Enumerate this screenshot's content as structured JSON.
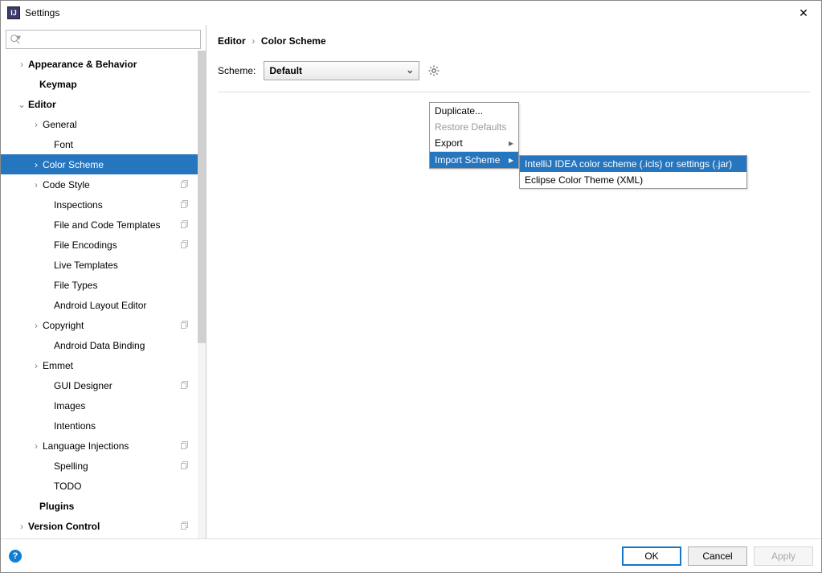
{
  "title": "Settings",
  "search_placeholder": "",
  "tree": [
    {
      "label": "Appearance & Behavior",
      "bold": true,
      "arrow": "›",
      "indent": 20,
      "copy": false
    },
    {
      "label": "Keymap",
      "bold": true,
      "arrow": "",
      "indent": 34,
      "copy": false
    },
    {
      "label": "Editor",
      "bold": true,
      "arrow": "⌄",
      "indent": 20,
      "copy": false
    },
    {
      "label": "General",
      "bold": false,
      "arrow": "›",
      "indent": 38,
      "copy": false
    },
    {
      "label": "Font",
      "bold": false,
      "arrow": "",
      "indent": 52,
      "copy": false
    },
    {
      "label": "Color Scheme",
      "bold": false,
      "arrow": "›",
      "indent": 38,
      "copy": false,
      "selected": true
    },
    {
      "label": "Code Style",
      "bold": false,
      "arrow": "›",
      "indent": 38,
      "copy": true
    },
    {
      "label": "Inspections",
      "bold": false,
      "arrow": "",
      "indent": 52,
      "copy": true
    },
    {
      "label": "File and Code Templates",
      "bold": false,
      "arrow": "",
      "indent": 52,
      "copy": true
    },
    {
      "label": "File Encodings",
      "bold": false,
      "arrow": "",
      "indent": 52,
      "copy": true
    },
    {
      "label": "Live Templates",
      "bold": false,
      "arrow": "",
      "indent": 52,
      "copy": false
    },
    {
      "label": "File Types",
      "bold": false,
      "arrow": "",
      "indent": 52,
      "copy": false
    },
    {
      "label": "Android Layout Editor",
      "bold": false,
      "arrow": "",
      "indent": 52,
      "copy": false
    },
    {
      "label": "Copyright",
      "bold": false,
      "arrow": "›",
      "indent": 38,
      "copy": true
    },
    {
      "label": "Android Data Binding",
      "bold": false,
      "arrow": "",
      "indent": 52,
      "copy": false
    },
    {
      "label": "Emmet",
      "bold": false,
      "arrow": "›",
      "indent": 38,
      "copy": false
    },
    {
      "label": "GUI Designer",
      "bold": false,
      "arrow": "",
      "indent": 52,
      "copy": true
    },
    {
      "label": "Images",
      "bold": false,
      "arrow": "",
      "indent": 52,
      "copy": false
    },
    {
      "label": "Intentions",
      "bold": false,
      "arrow": "",
      "indent": 52,
      "copy": false
    },
    {
      "label": "Language Injections",
      "bold": false,
      "arrow": "›",
      "indent": 38,
      "copy": true
    },
    {
      "label": "Spelling",
      "bold": false,
      "arrow": "",
      "indent": 52,
      "copy": true
    },
    {
      "label": "TODO",
      "bold": false,
      "arrow": "",
      "indent": 52,
      "copy": false
    },
    {
      "label": "Plugins",
      "bold": true,
      "arrow": "",
      "indent": 34,
      "copy": false
    },
    {
      "label": "Version Control",
      "bold": true,
      "arrow": "›",
      "indent": 20,
      "copy": true
    }
  ],
  "breadcrumb": {
    "a": "Editor",
    "b": "Color Scheme"
  },
  "scheme_label": "Scheme:",
  "scheme_value": "Default",
  "menu1": [
    {
      "label": "Duplicate...",
      "disabled": false,
      "sub": false
    },
    {
      "label": "Restore Defaults",
      "disabled": true,
      "sub": false
    },
    {
      "label": "Export",
      "disabled": false,
      "sub": true
    },
    {
      "sep": true
    },
    {
      "label": "Import Scheme",
      "disabled": false,
      "sub": true,
      "selected": true
    }
  ],
  "menu2": [
    {
      "label": "IntelliJ IDEA color scheme (.icls) or settings (.jar)",
      "selected": true
    },
    {
      "label": "Eclipse Color Theme (XML)",
      "selected": false
    }
  ],
  "buttons": {
    "ok": "OK",
    "cancel": "Cancel",
    "apply": "Apply"
  }
}
